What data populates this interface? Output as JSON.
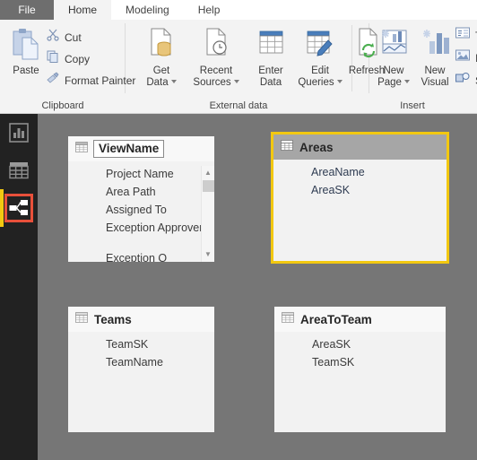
{
  "window": {
    "app": "Power BI Desktop",
    "canvas_bg": "#767676",
    "accent_selected": "#f2c811",
    "accent_highlight": "#e8503a"
  },
  "tabs": [
    {
      "label": "File",
      "id": "file",
      "active": false
    },
    {
      "label": "Home",
      "id": "home",
      "active": true
    },
    {
      "label": "Modeling",
      "id": "modeling",
      "active": false
    },
    {
      "label": "Help",
      "id": "help",
      "active": false
    }
  ],
  "ribbon": {
    "groups": [
      {
        "id": "clipboard",
        "label": "Clipboard"
      },
      {
        "id": "external-data",
        "label": "External data"
      },
      {
        "id": "insert",
        "label": "Insert"
      }
    ],
    "clipboard": {
      "paste": {
        "label": "Paste",
        "icon": "clipboard-paste-icon"
      },
      "cut": {
        "label": "Cut",
        "icon": "scissors-icon"
      },
      "copy": {
        "label": "Copy",
        "icon": "copy-icon"
      },
      "format_painter": {
        "label": "Format Painter",
        "icon": "paintbrush-icon"
      }
    },
    "external_data": {
      "get_data": {
        "label_line1": "Get",
        "label_line2": "Data",
        "icon": "get-data-icon",
        "has_menu": true
      },
      "recent_sources": {
        "label_line1": "Recent",
        "label_line2": "Sources",
        "icon": "recent-sources-icon",
        "has_menu": true
      },
      "enter_data": {
        "label_line1": "Enter",
        "label_line2": "Data",
        "icon": "enter-data-icon",
        "has_menu": false
      },
      "edit_queries": {
        "label_line1": "Edit",
        "label_line2": "Queries",
        "icon": "edit-queries-icon",
        "has_menu": true
      },
      "refresh": {
        "label_line1": "Refresh",
        "label_line2": "",
        "icon": "refresh-icon",
        "has_menu": false
      }
    },
    "insert": {
      "new_page": {
        "label_line1": "New",
        "label_line2": "Page",
        "icon": "new-page-icon",
        "has_menu": true
      },
      "new_visual": {
        "label_line1": "New",
        "label_line2": "Visual",
        "icon": "new-visual-icon",
        "has_menu": false
      },
      "text_box": {
        "label": "T",
        "icon": "text-box-icon"
      },
      "image": {
        "label": "In",
        "icon": "image-icon"
      },
      "shapes": {
        "label": "S",
        "icon": "shapes-icon"
      }
    }
  },
  "left_rail": {
    "items": [
      {
        "id": "report",
        "icon": "report-view-icon",
        "selected": false
      },
      {
        "id": "data",
        "icon": "data-view-icon",
        "selected": false
      },
      {
        "id": "model",
        "icon": "model-view-icon",
        "selected": true
      }
    ]
  },
  "model_canvas": {
    "tables": [
      {
        "id": "viewname",
        "name": "ViewName",
        "editing": true,
        "selected": false,
        "has_scrollbar": true,
        "fields": [
          "Project Name",
          "Area Path",
          "Assigned To",
          "Exception Approver"
        ],
        "clipped_field": "Exception O"
      },
      {
        "id": "areas",
        "name": "Areas",
        "editing": false,
        "selected": true,
        "has_scrollbar": false,
        "fields": [
          "AreaName",
          "AreaSK"
        ],
        "clipped_field": ""
      },
      {
        "id": "teams",
        "name": "Teams",
        "editing": false,
        "selected": false,
        "has_scrollbar": false,
        "fields": [
          "TeamSK",
          "TeamName"
        ],
        "clipped_field": ""
      },
      {
        "id": "areatoteam",
        "name": "AreaToTeam",
        "editing": false,
        "selected": false,
        "has_scrollbar": false,
        "fields": [
          "AreaSK",
          "TeamSK"
        ],
        "clipped_field": ""
      }
    ]
  }
}
